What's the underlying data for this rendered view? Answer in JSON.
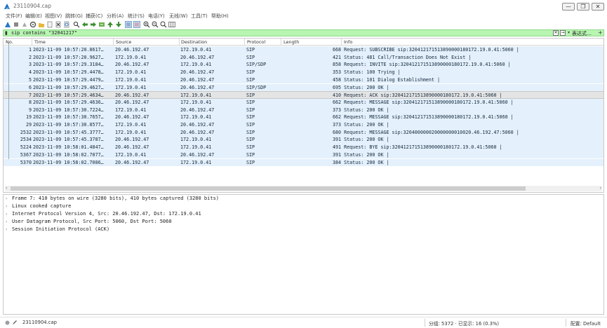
{
  "window": {
    "title": "23110904.cap",
    "minimize": "—",
    "maximize": "❐",
    "close": "✕"
  },
  "menu": [
    "文件(F)",
    "编辑(E)",
    "视图(V)",
    "跳转(G)",
    "捕获(C)",
    "分析(A)",
    "统计(S)",
    "电话(Y)",
    "无线(W)",
    "工具(T)",
    "帮助(H)"
  ],
  "filter": {
    "text": "sip contains \"32041217\"",
    "expression_label": "表达式…",
    "add_label": "+",
    "clear_label": "✕",
    "apply_label": "→",
    "dropdown_label": "▾",
    "bg_color": "#b7f5b1"
  },
  "packet_list": {
    "columns": [
      "No.",
      "Time",
      "Source",
      "Destination",
      "Protocol",
      "Length",
      "Info"
    ],
    "rows": [
      {
        "no": "1",
        "time": "2023-11-09 10:57:20.8617…",
        "src": "20.46.192.47",
        "dst": "172.19.0.41",
        "proto": "SIP",
        "info": "668 Request: SUBSCRIBE sip:320412171513890000180172.19.0.41:5060 |"
      },
      {
        "no": "2",
        "time": "2023-11-09 10:57:20.9627…",
        "src": "172.19.0.41",
        "dst": "20.46.192.47",
        "proto": "SIP",
        "info": "421 Status: 481 Call/Transaction Does Not Exist |"
      },
      {
        "no": "3",
        "time": "2023-11-09 10:57:29.3184…",
        "src": "20.46.192.47",
        "dst": "172.19.0.41",
        "proto": "SIP/SDP",
        "info": "858 Request: INVITE sip:320412171513890000180172.19.0.41:5060 |"
      },
      {
        "no": "4",
        "time": "2023-11-09 10:57:29.4478…",
        "src": "172.19.0.41",
        "dst": "20.46.192.47",
        "proto": "SIP",
        "info": "353 Status: 100 Trying |"
      },
      {
        "no": "5",
        "time": "2023-11-09 10:57:29.4479…",
        "src": "172.19.0.41",
        "dst": "20.46.192.47",
        "proto": "SIP",
        "info": "458 Status: 101 Dialog Establishment |"
      },
      {
        "no": "6",
        "time": "2023-11-09 10:57:29.4627…",
        "src": "172.19.0.41",
        "dst": "20.46.192.47",
        "proto": "SIP/SDP",
        "info": "695 Status: 200 OK |"
      },
      {
        "no": "7",
        "time": "2023-11-09 10:57:29.4634…",
        "src": "20.46.192.47",
        "dst": "172.19.0.41",
        "proto": "SIP",
        "info": "410 Request: ACK sip:320412171513890000180172.19.0.41:5060 |"
      },
      {
        "no": "8",
        "time": "2023-11-09 10:57:29.4636…",
        "src": "20.46.192.47",
        "dst": "172.19.0.41",
        "proto": "SIP",
        "info": "662 Request: MESSAGE sip:320412171513890000180172.19.0.41:5060 |"
      },
      {
        "no": "9",
        "time": "2023-11-09 10:57:30.7224…",
        "src": "172.19.0.41",
        "dst": "20.46.192.47",
        "proto": "SIP",
        "info": "373 Status: 200 OK |"
      },
      {
        "no": "19",
        "time": "2023-11-09 10:57:30.7657…",
        "src": "20.46.192.47",
        "dst": "172.19.0.41",
        "proto": "SIP",
        "info": "662 Request: MESSAGE sip:320412171513890000180172.19.0.41:5060 |"
      },
      {
        "no": "29",
        "time": "2023-11-09 10:57:30.8577…",
        "src": "172.19.0.41",
        "dst": "20.46.192.47",
        "proto": "SIP",
        "info": "373 Status: 200 OK |"
      },
      {
        "no": "2532",
        "time": "2023-11-09 10:57:45.3777…",
        "src": "172.19.0.41",
        "dst": "20.46.192.47",
        "proto": "SIP",
        "info": "680 Request: MESSAGE sip:320400000020000000010020.46.192.47:5060 |"
      },
      {
        "no": "2534",
        "time": "2023-11-09 10:57:45.3787…",
        "src": "20.46.192.47",
        "dst": "172.19.0.41",
        "proto": "SIP",
        "info": "391 Status: 200 OK |"
      },
      {
        "no": "5224",
        "time": "2023-11-09 10:58:01.4847…",
        "src": "20.46.192.47",
        "dst": "172.19.0.41",
        "proto": "SIP",
        "info": "491 Request: BYE sip:320412171513890000180172.19.0.41:5060 |"
      },
      {
        "no": "5367",
        "time": "2023-11-09 10:58:02.7077…",
        "src": "172.19.0.41",
        "dst": "20.46.192.47",
        "proto": "SIP",
        "info": "391 Status: 200 OK |"
      },
      {
        "no": "5370",
        "time": "2023-11-09 10:58:02.7086…",
        "src": "20.46.192.47",
        "dst": "172.19.0.41",
        "proto": "SIP",
        "info": "384 Status: 200 OK |"
      }
    ],
    "selected_no": "7",
    "row_color": "#e4f0fb",
    "selected_color": "#e4e4e4"
  },
  "details": [
    "Frame 7: 410 bytes on wire (3280 bits), 410 bytes captured (3280 bits)",
    "Linux cooked capture",
    "Internet Protocol Version 4, Src: 20.46.192.47, Dst: 172.19.0.41",
    "User Datagram Protocol, Src Port: 5060, Dst Port: 5060",
    "Session Initiation Protocol (ACK)"
  ],
  "status": {
    "file": "23110904.cap",
    "counts": "分组: 5372 · 已显示: 16 (0.3%)",
    "profile": "配置: Default"
  }
}
